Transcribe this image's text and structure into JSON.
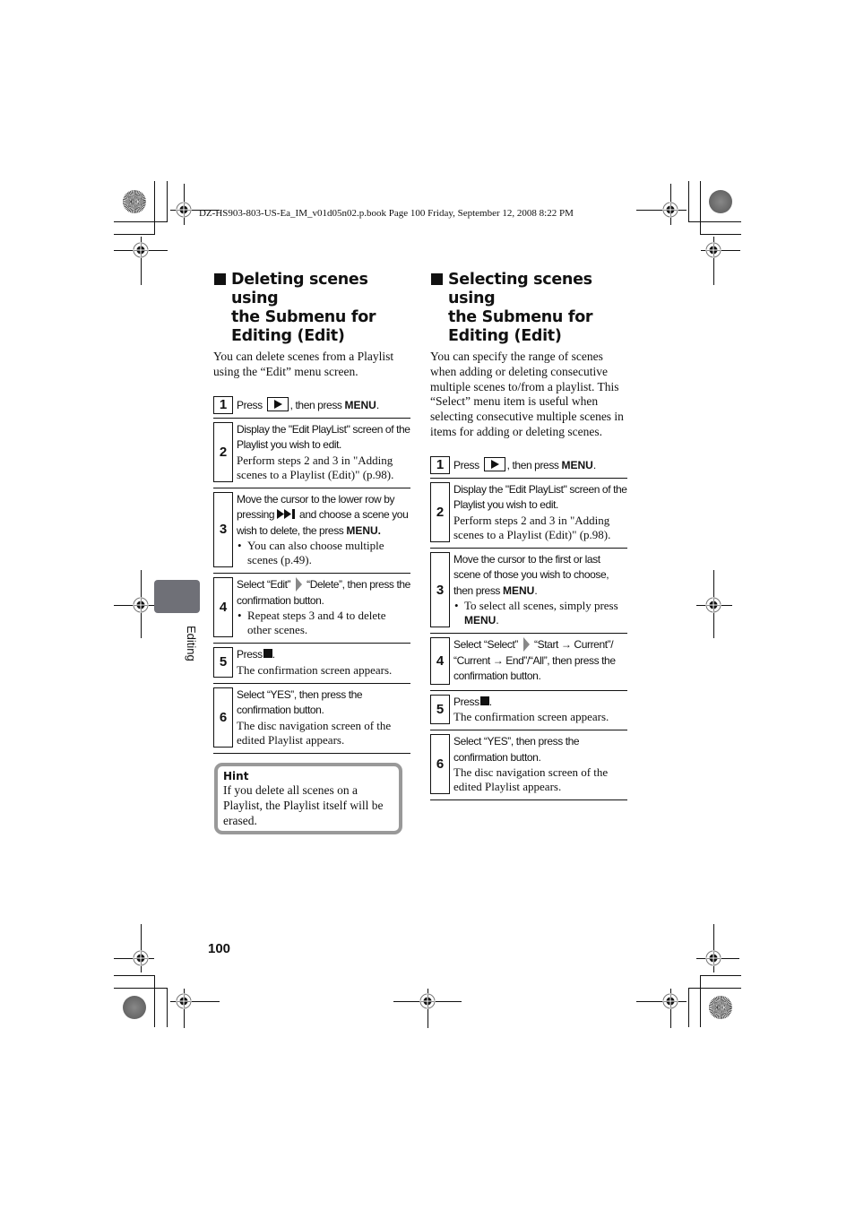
{
  "header": {
    "file_info": "DZ-HS903-803-US-Ea_IM_v01d05n02.p.book  Page 100  Friday, September 12, 2008  8:22 PM"
  },
  "side_tab": {
    "label": "Editing"
  },
  "page_number": "100",
  "left_section": {
    "title": "Deleting scenes using the Submenu for Editing (Edit)",
    "title_lines": [
      "Deleting scenes using",
      "the Submenu for",
      "Editing (Edit)"
    ],
    "intro": "You can delete scenes from a Playlist using the “Edit” menu screen.",
    "steps": [
      {
        "num": "1",
        "main_pre": "Press",
        "main_mid": ", then press",
        "main_bold": "MENU",
        "main_post": "."
      },
      {
        "num": "2",
        "main": "Display the \"Edit PlayList\" screen of the Playlist you wish to edit.",
        "sub": "Perform steps 2 and 3 in \"Adding scenes to a Playlist (Edit)\" (p.98)."
      },
      {
        "num": "3",
        "main_pre": "Move the cursor to the lower row by pressing",
        "main_mid": "and choose a scene you wish to delete, the press",
        "main_bold": "MENU.",
        "bullet": "You can also choose multiple scenes (p.49)."
      },
      {
        "num": "4",
        "main_pre": "Select “Edit”",
        "main_post": "“Delete”, then press the confirmation button.",
        "bullet": "Repeat steps 3 and 4 to delete other scenes."
      },
      {
        "num": "5",
        "main_pre": "Press",
        "main_post": ".",
        "sub": "The confirmation screen appears."
      },
      {
        "num": "6",
        "main": "Select “YES”, then press the confirmation button.",
        "sub": "The disc navigation screen of the edited Playlist appears."
      }
    ],
    "hint": {
      "title": "Hint",
      "body": "If you delete all scenes on a Playlist, the Playlist itself will be erased."
    }
  },
  "right_section": {
    "title": "Selecting scenes using the Submenu for Editing (Edit)",
    "title_lines": [
      "Selecting scenes using",
      "the Submenu for",
      "Editing (Edit)"
    ],
    "intro": "You can specify the range of scenes when adding or deleting consecutive multiple scenes to/from a playlist. This “Select” menu item is useful when selecting consecutive multiple scenes in items for adding or deleting scenes.",
    "steps": [
      {
        "num": "1",
        "main_pre": "Press",
        "main_mid": ", then press",
        "main_bold": "MENU",
        "main_post": "."
      },
      {
        "num": "2",
        "main": "Display the \"Edit PlayList\" screen of the Playlist you wish to edit.",
        "sub": "Perform steps 2 and 3 in \"Adding scenes to a Playlist (Edit)\" (p.98)."
      },
      {
        "num": "3",
        "main_pre": "Move the cursor to the first or last scene of those you wish to choose, then press",
        "main_bold": "MENU",
        "main_post": ".",
        "bullet_pre": "To select all scenes, simply press",
        "bullet_bold": "MENU",
        "bullet_post": "."
      },
      {
        "num": "4",
        "main_pre": "Select “Select”",
        "main_post": "“Start → Current”/ “Current → End”/“All”, then press the confirmation button."
      },
      {
        "num": "5",
        "main_pre": "Press",
        "main_post": ".",
        "sub": "The confirmation screen appears."
      },
      {
        "num": "6",
        "main": "Select “YES”, then press the confirmation button.",
        "sub": "The disc navigation screen of the edited Playlist appears."
      }
    ]
  }
}
